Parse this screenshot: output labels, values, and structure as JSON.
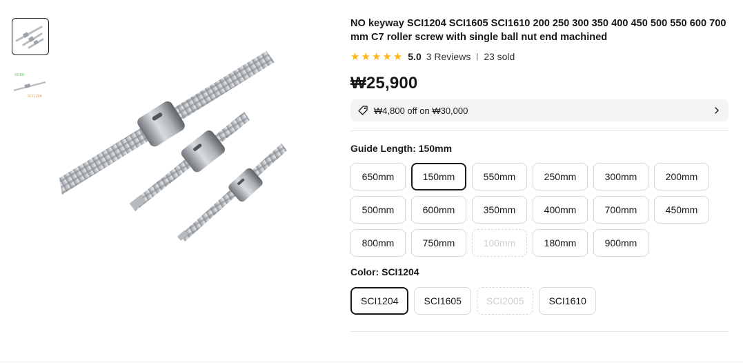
{
  "product": {
    "title": "NO keyway SCI1204 SCI1605 SCI1610 200 250 300 350 400 450 500 550 600 700 mm C7 roller screw with single ball nut end machined",
    "rating_score": "5.0",
    "reviews": "3 Reviews",
    "separator": "|",
    "sold": "23 sold",
    "price": "₩25,900",
    "coupon": "₩4,800 off on ₩30,000"
  },
  "thumbnails": [
    {
      "label": "",
      "active": true
    },
    {
      "label_top": "ROBB",
      "label_bottom": "SCI1204",
      "active": false
    }
  ],
  "guide_length": {
    "label": "Guide Length: ",
    "selected": "150mm",
    "options": [
      {
        "label": "650mm",
        "state": "normal"
      },
      {
        "label": "150mm",
        "state": "selected"
      },
      {
        "label": "550mm",
        "state": "normal"
      },
      {
        "label": "250mm",
        "state": "normal"
      },
      {
        "label": "300mm",
        "state": "normal"
      },
      {
        "label": "200mm",
        "state": "normal"
      },
      {
        "label": "500mm",
        "state": "normal"
      },
      {
        "label": "600mm",
        "state": "normal"
      },
      {
        "label": "350mm",
        "state": "normal"
      },
      {
        "label": "400mm",
        "state": "normal"
      },
      {
        "label": "700mm",
        "state": "normal"
      },
      {
        "label": "450mm",
        "state": "normal"
      },
      {
        "label": "800mm",
        "state": "normal"
      },
      {
        "label": "750mm",
        "state": "normal"
      },
      {
        "label": "100mm",
        "state": "disabled"
      },
      {
        "label": "180mm",
        "state": "normal"
      },
      {
        "label": "900mm",
        "state": "normal"
      }
    ]
  },
  "color": {
    "label": "Color: ",
    "selected": "SCI1204",
    "options": [
      {
        "label": "SCI1204",
        "state": "selected"
      },
      {
        "label": "SCI1605",
        "state": "normal"
      },
      {
        "label": "SCI2005",
        "state": "disabled"
      },
      {
        "label": "SCI1610",
        "state": "normal"
      }
    ]
  },
  "colors": {
    "star": "#fdb618",
    "text": "#191919",
    "border": "#d8d8d8",
    "coupon_bg": "#f4f4f4",
    "thumb_green": "#7cc576",
    "thumb_orange": "#f29b2f"
  }
}
